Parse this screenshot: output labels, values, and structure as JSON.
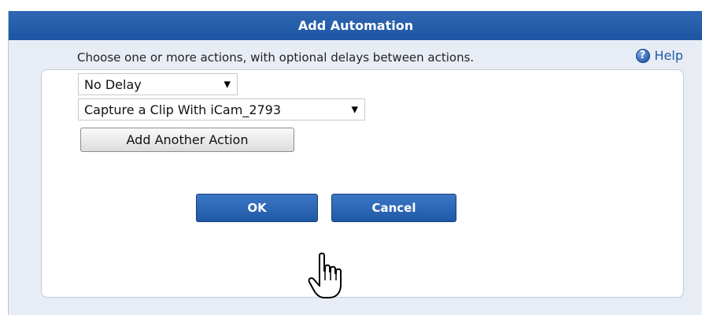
{
  "dialog": {
    "title": "Add Automation",
    "help_label": "Help",
    "help_icon": "question-circle-icon",
    "instructions": "Choose one or more actions, with optional delays between actions.",
    "delay_select": {
      "value": "No Delay"
    },
    "action_select": {
      "value": "Capture a Clip With iCam_2793"
    },
    "add_action_label": "Add Another Action",
    "ok_label": "OK",
    "cancel_label": "Cancel"
  },
  "cursor": {
    "icon": "hand-pointer-icon"
  },
  "colors": {
    "titlebar": "#2a63b0",
    "dialog_background": "#e8edf5",
    "primary_button": "#2f69b8",
    "link": "#1e5aa8"
  }
}
